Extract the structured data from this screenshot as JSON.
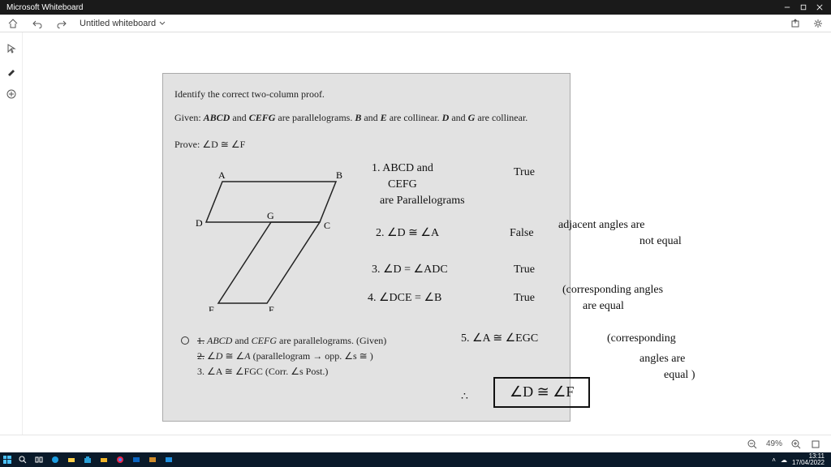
{
  "app": {
    "title": "Microsoft Whiteboard"
  },
  "topbar": {
    "doc_title": "Untitled whiteboard"
  },
  "document": {
    "instruction": "Identify the correct two-column proof.",
    "given_label": "Given:",
    "given_text": "ABCD and CEFG are parallelograms. B and E are collinear. D and G are collinear.",
    "prove_label": "Prove:",
    "prove_text": "∠D ≅ ∠F",
    "figure_labels": {
      "A": "A",
      "B": "B",
      "C": "C",
      "D": "D",
      "E": "E",
      "F": "F",
      "G": "G"
    },
    "proof_lines": {
      "l1a": "1.",
      "l1b": "ABCD and CEFG are parallelograms. (Given)",
      "l2a": "2.",
      "l2b": "∠D ≅ ∠A (parallelogram → opp. ∠s ≅ )",
      "l3": "3. ∠A ≅ ∠FGC (Corr. ∠s Post.)"
    }
  },
  "handwriting": {
    "h1": "1. ABCD and",
    "h1b": "CEFG",
    "h1c": "are Parallelograms",
    "h1r": "True",
    "h2": "2. ∠D ≅ ∠A",
    "h2r": "False",
    "h2e": "adjacent angles are",
    "h2e2": "not equal",
    "h3": "3. ∠D = ∠ADC",
    "h3r": "True",
    "h4": "4. ∠DCE = ∠B",
    "h4r": "True",
    "h4e": "(corresponding angles",
    "h4e2": "are equal",
    "h5": "5. ∠A ≅ ∠EGC",
    "h5e": "(corresponding",
    "h5e2": "angles are",
    "h5e3": "equal )",
    "box": "∠D ≅ ∠F",
    "dots": "∴"
  },
  "zoom": {
    "percent": "49%"
  },
  "system": {
    "time": "13:11",
    "date": "17/04/2022"
  },
  "taskbar_apps": [
    "start",
    "search",
    "taskview",
    "edge",
    "files",
    "store",
    "folder",
    "chrome",
    "outlook",
    "word",
    "paint"
  ]
}
